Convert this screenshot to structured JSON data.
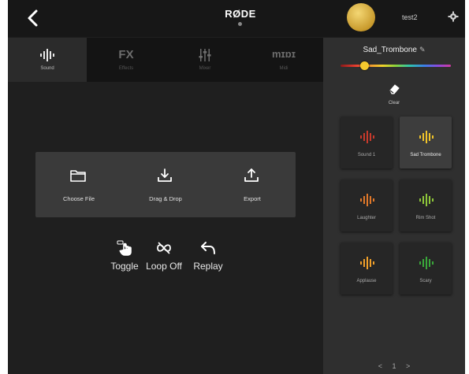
{
  "header": {
    "brand": "RØDE",
    "username": "test2"
  },
  "tabs": [
    {
      "label": "FX",
      "sublabel": "Effects",
      "icon": "fx-text"
    },
    {
      "label": "mɪɒɪ",
      "sublabel": "Midi",
      "icon": "midi-text"
    }
  ],
  "tab_icons": [
    {
      "name": "sound-wave-icon",
      "sublabel": "Sound",
      "active": true
    },
    {
      "name": "mixer-sliders-icon",
      "sublabel": "Mixer",
      "active": false
    }
  ],
  "actions": {
    "choose_file": "Choose File",
    "drag_drop": "Drag & Drop",
    "export": "Export"
  },
  "controls": {
    "toggle": "Toggle",
    "loop": "Loop Off",
    "replay": "Replay"
  },
  "side": {
    "sound_name": "Sad_Trombone",
    "color_level": 0.22,
    "clear_label": "Clear",
    "pads": [
      {
        "label": "Sound 1",
        "color": "#c83a2c"
      },
      {
        "label": "Sad Trombone",
        "color": "#f0c42a",
        "active": true
      },
      {
        "label": "Laughter",
        "color": "#e0782a"
      },
      {
        "label": "Rim Shot",
        "color": "#8ec63a"
      },
      {
        "label": "Applause",
        "color": "#f0a02a"
      },
      {
        "label": "Scary",
        "color": "#3aa83a"
      }
    ],
    "pager": {
      "prev": "<",
      "page": "1",
      "next": ">"
    }
  }
}
